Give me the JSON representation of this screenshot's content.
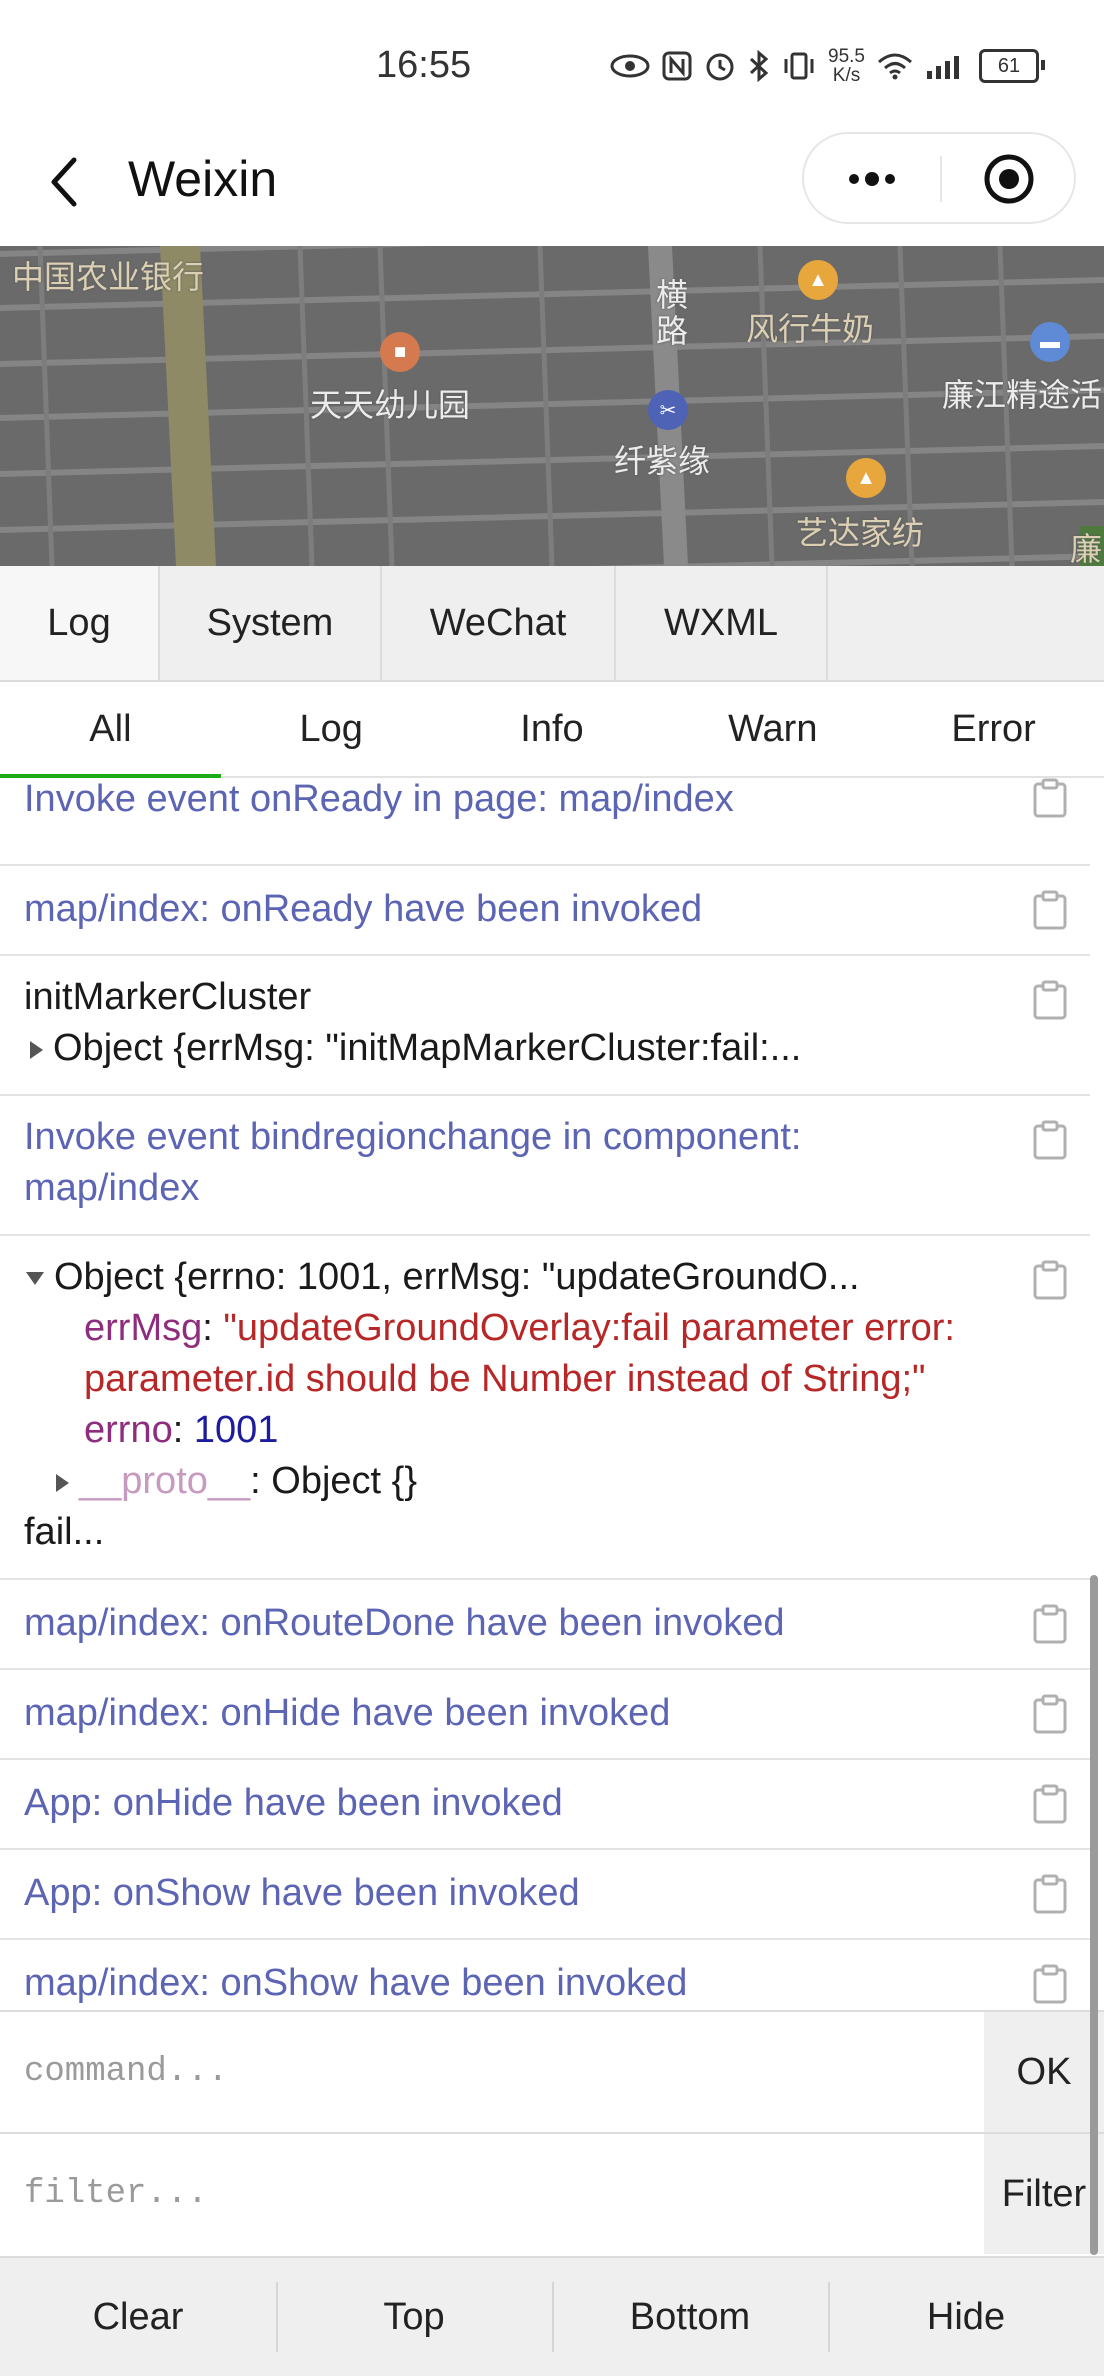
{
  "status_bar": {
    "time": "16:55",
    "speed_value": "95.5",
    "speed_unit": "K/s",
    "battery": "61",
    "icons": [
      "eye-icon",
      "nfc-icon",
      "alarm-icon",
      "bluetooth-icon",
      "vibrate-icon",
      "wifi-icon",
      "signal-icon",
      "battery-icon"
    ]
  },
  "nav": {
    "title": "Weixin",
    "icons": [
      "back-icon",
      "more-icon",
      "record-icon"
    ]
  },
  "map": {
    "pois": [
      {
        "label": "中国农业银行",
        "icon": "none"
      },
      {
        "label": "横",
        "icon": "none"
      },
      {
        "label": "路",
        "icon": "none"
      },
      {
        "label": "风行牛奶",
        "icon": "shop-icon"
      },
      {
        "label": "廉江精途活",
        "icon": "building-icon"
      },
      {
        "label": "天天幼儿园",
        "icon": "school-icon"
      },
      {
        "label": "纤紫缘",
        "icon": "scissors-icon"
      },
      {
        "label": "艺达家纺",
        "icon": "shop-icon"
      },
      {
        "label": "廉",
        "icon": "none"
      }
    ]
  },
  "main_tabs": [
    "Log",
    "System",
    "WeChat",
    "WXML"
  ],
  "sub_tabs": [
    "All",
    "Log",
    "Info",
    "Warn",
    "Error"
  ],
  "logs": [
    {
      "text": "Invoke event onReady in page: map/index"
    },
    {
      "text": "map/index: onReady have been invoked"
    },
    {
      "line1": "initMarkerCluster",
      "line2": "Object {errMsg: \"initMapMarkerCluster:fail:..."
    },
    {
      "line1": "Invoke event bindregionchange in component:",
      "line2": "map/index"
    },
    {
      "header": "Object {errno: 1001, errMsg: \"updateGroundO...",
      "err_key": "errMsg",
      "err_val_1": "\"updateGroundOverlay:fail parameter error:",
      "err_val_2": "parameter.id should be Number instead of String;\"",
      "errno_key": "errno",
      "errno_val": "1001",
      "proto_key": "__proto__",
      "proto_val": "Object {}",
      "tail": "fail..."
    },
    {
      "text": "map/index: onRouteDone have been invoked"
    },
    {
      "text": "map/index: onHide have been invoked"
    },
    {
      "text": "App: onHide have been invoked"
    },
    {
      "text": "App: onShow have been invoked"
    },
    {
      "text": "map/index: onShow have been invoked"
    }
  ],
  "command": {
    "placeholder": "command...",
    "button": "OK"
  },
  "filter": {
    "placeholder": "filter...",
    "button": "Filter"
  },
  "toolbar": [
    "Clear",
    "Top",
    "Bottom",
    "Hide"
  ],
  "colors": {
    "accent": "#1aad19",
    "log_blue": "#5c64b4",
    "error_red": "#b82727"
  }
}
